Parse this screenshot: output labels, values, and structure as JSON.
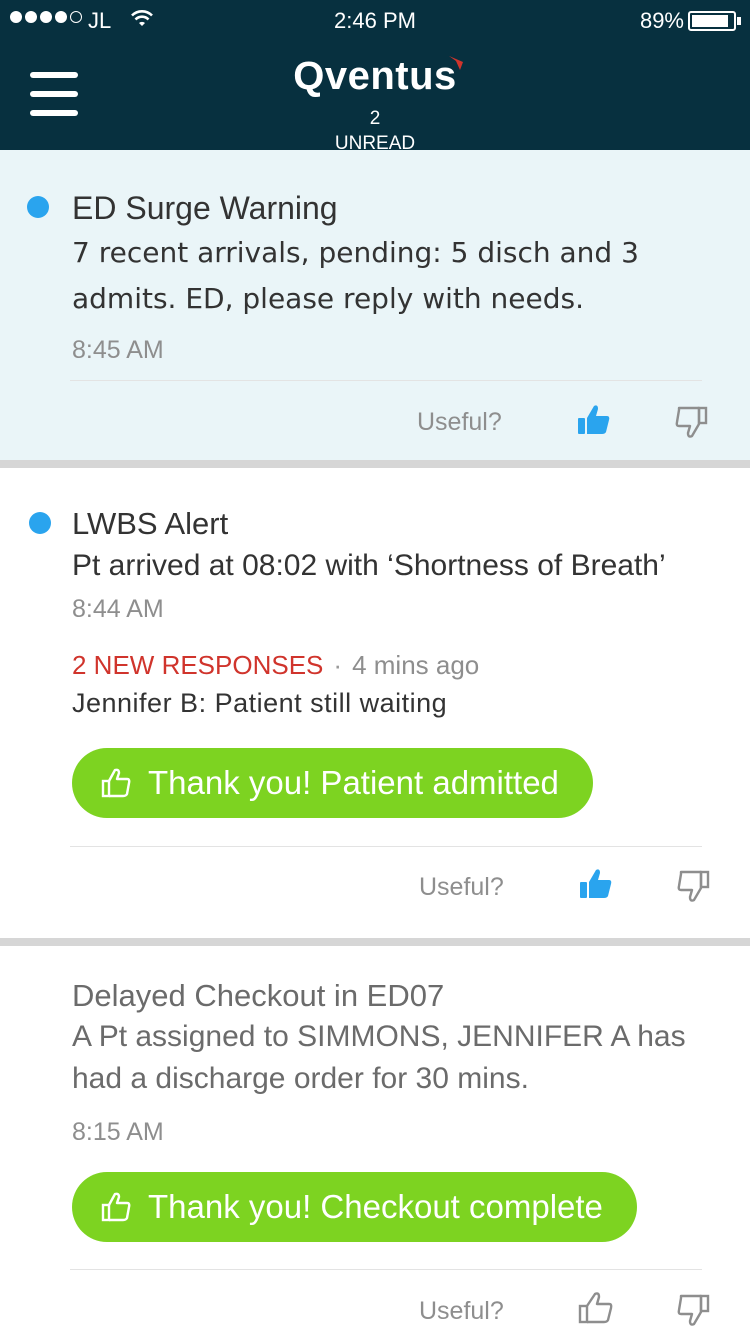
{
  "status_bar": {
    "carrier": "JL",
    "time": "2:46 PM",
    "battery_percent": "89%",
    "battery_level": 0.89
  },
  "header": {
    "logo_text": "Qventus",
    "unread_count": "2",
    "unread_label": "UNREAD"
  },
  "colors": {
    "header_bg": "#07303f",
    "unread_dot": "#2aa4ee",
    "new_responses": "#d0342c",
    "action_button": "#7dd321",
    "thumb_active": "#2aa4ee"
  },
  "alerts": [
    {
      "title": "ED Surge Warning",
      "body": "7 recent arrivals, pending: 5 disch and 3 admits. ED, please reply with needs.",
      "time": "8:45 AM",
      "unread": true,
      "useful_label": "Useful?",
      "thumbs_up_active": true
    },
    {
      "title": "LWBS Alert",
      "body": "Pt arrived at 08:02 with ‘Shortness of Breath’",
      "time": "8:44 AM",
      "unread": true,
      "responses_label": "2 NEW RESPONSES",
      "responses_separator": "·",
      "responses_time": "4 mins ago",
      "response_message": "Jennifer B: Patient still waiting",
      "action_label": "Thank you! Patient admitted",
      "useful_label": "Useful?",
      "thumbs_up_active": true
    },
    {
      "title": "Delayed Checkout in ED07",
      "body": "A Pt assigned to SIMMONS, JENNIFER A has had a discharge order for 30 mins.",
      "time": "8:15 AM",
      "unread": false,
      "action_label": "Thank you! Checkout complete",
      "useful_label": "Useful?",
      "thumbs_up_active": false
    }
  ]
}
